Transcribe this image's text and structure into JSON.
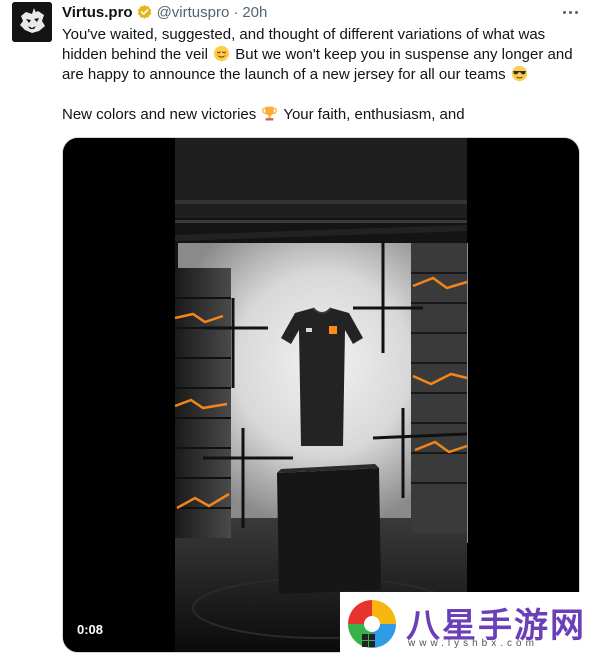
{
  "tweet": {
    "author_name": "Virtus.pro",
    "handle": "@virtuspro",
    "separator": "·",
    "time": "20h",
    "avatar_icon": "virtuspro-bear-logo",
    "verified_icon": "gold-verified-badge",
    "text_line1_a": "You've waited, suggested, and thought of different variations of what was hidden behind the veil",
    "text_line1_b": "But we won't keep you in suspense any longer and are happy to announce the launch of a new jersey for all our teams",
    "text_line2_a": "New colors and new victories",
    "text_line2_b": "Your faith, enthusiasm, and",
    "emoji_1": "relieved-face",
    "emoji_2": "smiling-face-with-sunglasses",
    "emoji_3": "trophy"
  },
  "media": {
    "type": "video",
    "duration": "0:08",
    "description_icon": "jersey-reveal-video"
  },
  "watermark": {
    "title": "八星手游网",
    "url": "www.lyshbx.com"
  }
}
